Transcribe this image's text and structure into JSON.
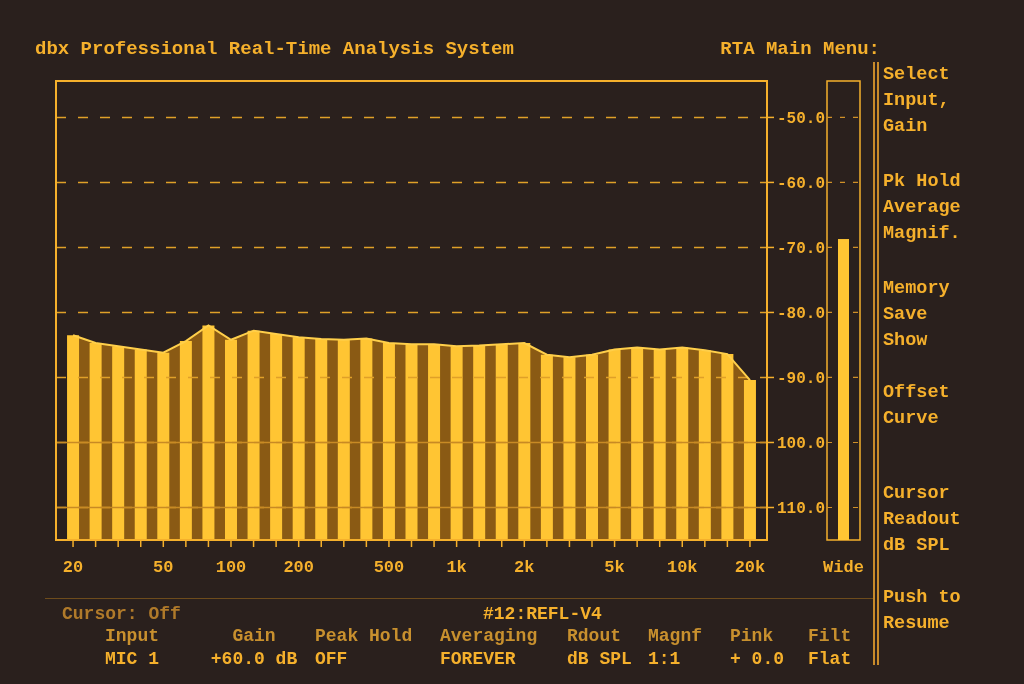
{
  "header": {
    "title": "dbx Professional Real-Time Analysis System",
    "menu_title": "RTA Main Menu:"
  },
  "spectrum": {
    "chart_data": {
      "type": "line",
      "categories": [
        "20",
        null,
        null,
        null,
        "50",
        null,
        null,
        "100",
        null,
        null,
        "200",
        null,
        null,
        null,
        "500",
        null,
        null,
        "1k",
        null,
        null,
        "2k",
        null,
        null,
        null,
        "5k",
        null,
        null,
        "10k",
        null,
        null,
        "20k"
      ],
      "values": [
        -83.5,
        -84.7,
        -85.2,
        -85.7,
        -86.2,
        -84.4,
        -82.0,
        -84.2,
        -82.8,
        -83.3,
        -83.8,
        -84.1,
        -84.2,
        -84.0,
        -84.7,
        -84.9,
        -84.9,
        -85.2,
        -85.1,
        -84.9,
        -84.7,
        -86.5,
        -86.9,
        -86.5,
        -85.7,
        -85.4,
        -85.7,
        -85.4,
        -85.8,
        -86.4,
        -90.4
      ],
      "ylim": [
        -115,
        -44.4
      ],
      "grid": true,
      "yticks": [
        {
          "value": -50,
          "label": "-50.0"
        },
        {
          "value": -60,
          "label": "-60.0"
        },
        {
          "value": -70,
          "label": "-70.0"
        },
        {
          "value": -80,
          "label": "-80.0"
        },
        {
          "value": -90,
          "label": "-90.0"
        },
        {
          "value": -100,
          "label": "100.0"
        },
        {
          "value": -110,
          "label": "110.0"
        }
      ]
    }
  },
  "meter": {
    "label": "Wide",
    "level": 0.66
  },
  "status": {
    "cursor": "Cursor: Off",
    "preset": "#12:REFL-V4"
  },
  "settings": [
    {
      "label": "Input",
      "value": "MIC 1"
    },
    {
      "label": "Gain",
      "value": "+60.0 dB"
    },
    {
      "label": "Peak Hold",
      "value": "OFF"
    },
    {
      "label": "Averaging",
      "value": "FOREVER"
    },
    {
      "label": "Rdout",
      "value": "dB SPL"
    },
    {
      "label": "Magnf",
      "value": "1:1"
    },
    {
      "label": "Pink",
      "value": "+ 0.0"
    },
    {
      "label": "Filt",
      "value": "Flat"
    }
  ],
  "menu": {
    "items": [
      {
        "lines": [
          "Select",
          "Input,",
          "Gain"
        ]
      },
      {
        "lines": [
          "Pk Hold",
          "Average",
          "Magnif."
        ]
      },
      {
        "lines": [
          "Memory",
          "Save",
          "Show"
        ]
      },
      {
        "lines": [
          "Offset",
          "Curve"
        ]
      },
      {
        "lines": [
          "Cursor",
          "Readout",
          "dB SPL"
        ]
      },
      {
        "lines": [
          "Push to",
          "Resume"
        ]
      }
    ]
  }
}
